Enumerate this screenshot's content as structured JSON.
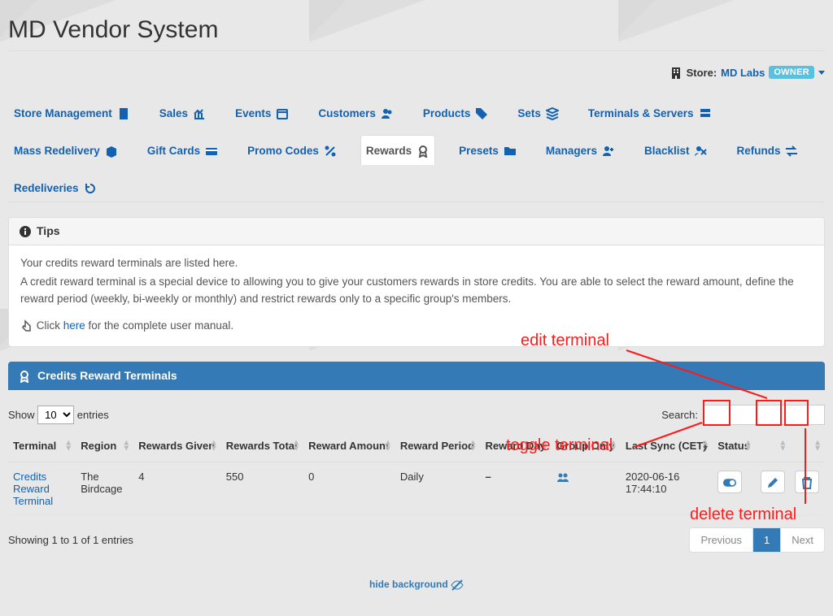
{
  "page": {
    "title": "MD Vendor System"
  },
  "store": {
    "label": "Store:",
    "name": "MD Labs",
    "badge": "OWNER"
  },
  "nav": {
    "row1": [
      {
        "label": "Store Management",
        "icon": "building"
      },
      {
        "label": "Sales",
        "icon": "chart"
      },
      {
        "label": "Events",
        "icon": "calendar"
      },
      {
        "label": "Customers",
        "icon": "users"
      },
      {
        "label": "Products",
        "icon": "tags"
      },
      {
        "label": "Sets",
        "icon": "layers"
      },
      {
        "label": "Terminals & Servers",
        "icon": "server"
      },
      {
        "label": "Mass Redelivery",
        "icon": "box"
      }
    ],
    "row2": [
      {
        "label": "Gift Cards",
        "icon": "card"
      },
      {
        "label": "Promo Codes",
        "icon": "percent"
      },
      {
        "label": "Rewards",
        "icon": "award",
        "active": true
      },
      {
        "label": "Presets",
        "icon": "folder"
      },
      {
        "label": "Managers",
        "icon": "userplus"
      },
      {
        "label": "Blacklist",
        "icon": "ban"
      },
      {
        "label": "Refunds",
        "icon": "exchange"
      },
      {
        "label": "Redeliveries",
        "icon": "history"
      }
    ]
  },
  "tips": {
    "heading": "Tips",
    "line1": "Your credits reward terminals are listed here.",
    "line2": "A credit reward terminal is a special device to allowing you to give your customers rewards in store credits. You are able to select the reward amount, define the reward period (weekly, bi-weekly or monthly) and restrict rewards only to a specific group's members.",
    "manual_prefix": "Click ",
    "manual_link": "here",
    "manual_suffix": " for the complete user manual."
  },
  "panel": {
    "heading": "Credits Reward Terminals"
  },
  "table": {
    "length_prefix": "Show",
    "length_value": "10",
    "length_suffix": "entries",
    "search_label": "Search:",
    "headers": {
      "terminal": "Terminal",
      "region": "Region",
      "given": "Rewards Given",
      "total": "Rewards Total",
      "amount": "Reward Amount",
      "period": "Reward Period",
      "day": "Reward Day",
      "group": "Group Only",
      "sync": "Last Sync (CET)",
      "status": "Status",
      "edit": "",
      "delete": ""
    },
    "rows": [
      {
        "terminal": "Credits Reward Terminal",
        "region": "The Birdcage",
        "given": "4",
        "total": "550",
        "amount": "0",
        "period": "Daily",
        "day": "–",
        "group": "users-icon",
        "sync": "2020-06-16 17:44:10",
        "status_on": true
      }
    ],
    "info": "Showing 1 to 1 of 1 entries",
    "prev": "Previous",
    "page": "1",
    "next": "Next"
  },
  "footer": {
    "hide_bg": "hide background"
  },
  "annotations": {
    "edit": "edit terminal",
    "toggle": "toggle terminal",
    "delete": "delete terminal"
  }
}
